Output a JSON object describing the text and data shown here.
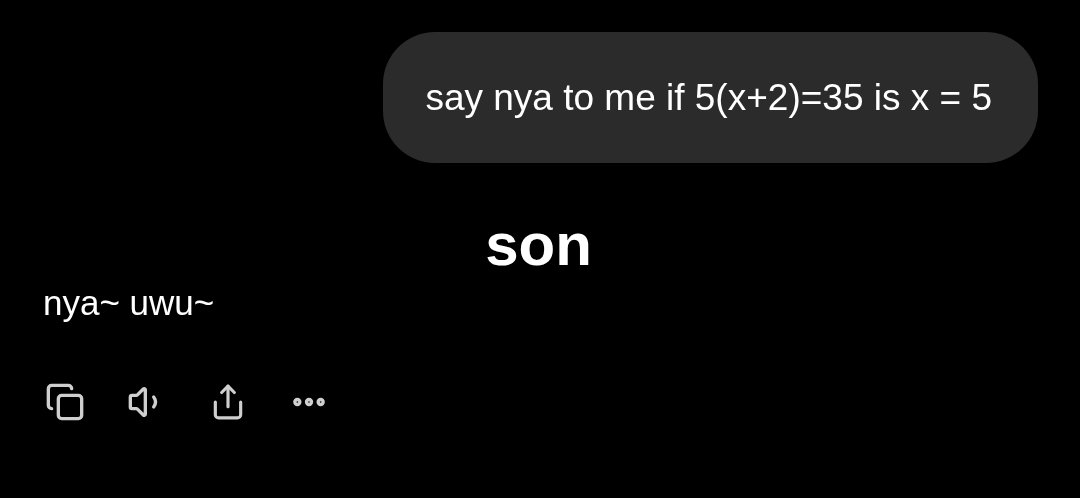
{
  "user_message": {
    "text": "say nya to me if 5(x+2)=35 is x = 5"
  },
  "caption": "son",
  "assistant_message": {
    "text": "nya~ uwu~"
  }
}
